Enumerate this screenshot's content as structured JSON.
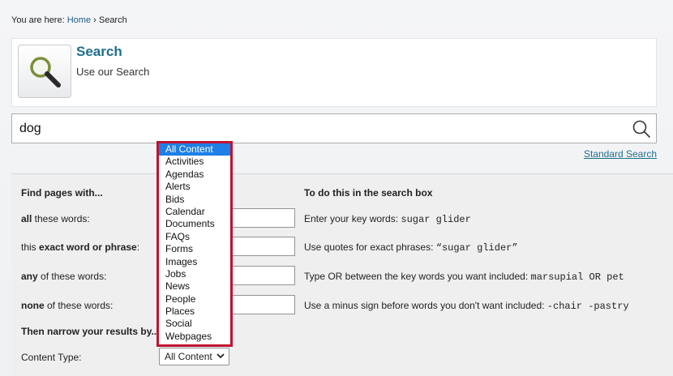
{
  "breadcrumb": {
    "prefix": "You are here:",
    "home": "Home",
    "separator": "›",
    "current": "Search"
  },
  "header": {
    "title": "Search",
    "subtitle": "Use our Search",
    "icon": "magnifier-icon"
  },
  "search": {
    "value": "dog",
    "button_icon": "search-icon"
  },
  "standard_search_link": "Standard Search",
  "advanced": {
    "find_heading": "Find pages with...",
    "todo_heading": "To do this in the search box",
    "rows": [
      {
        "label_bold": "all",
        "label_rest": " these words:",
        "help_text": "Enter your key words: ",
        "help_code": "sugar glider"
      },
      {
        "label_pre": "this ",
        "label_bold": "exact word or phrase",
        "label_rest": ":",
        "help_text": "Use quotes for exact phrases: ",
        "help_code": "“sugar glider”"
      },
      {
        "label_bold": "any",
        "label_rest": " of these words:",
        "help_text": "Type OR between the key words you want included: ",
        "help_code": "marsupial OR pet"
      },
      {
        "label_bold": "none",
        "label_rest": " of these words:",
        "help_text": "Use a minus sign before words you don't want included: ",
        "help_code": "-chair -pastry"
      }
    ],
    "narrow_heading": "Then narrow your results by...",
    "content_type_label": "Content Type:",
    "content_type_selected": "All Content"
  },
  "dropdown": {
    "options": [
      "All Content",
      "Activities",
      "Agendas",
      "Alerts",
      "Bids",
      "Calendar",
      "Documents",
      "FAQs",
      "Forms",
      "Images",
      "Jobs",
      "News",
      "People",
      "Places",
      "Social",
      "Webpages"
    ],
    "selected_index": 0
  },
  "colors": {
    "accent": "#1e6f8c",
    "link": "#1e5d8a",
    "highlight_border": "#c1122f",
    "selected_option": "#1e7fe6"
  }
}
